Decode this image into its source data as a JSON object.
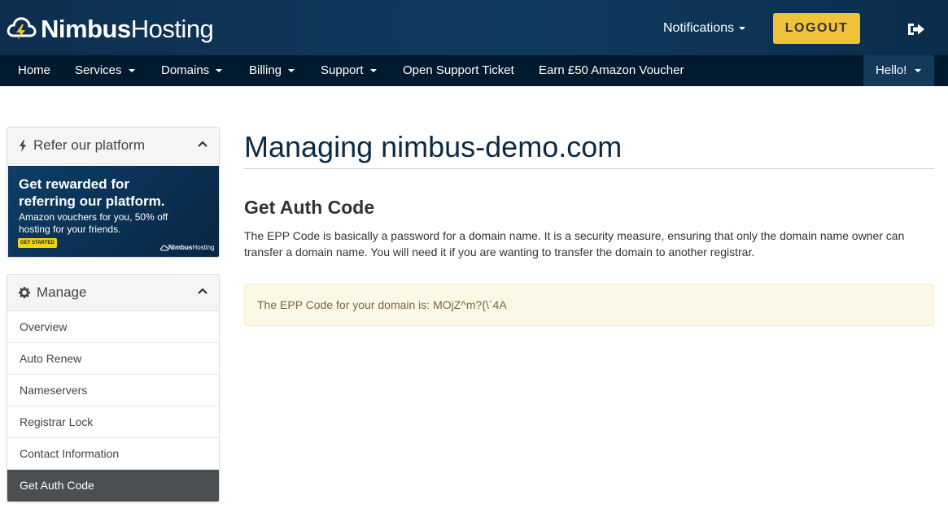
{
  "brand": {
    "bold": "Nimbus",
    "light": "Hosting"
  },
  "header": {
    "notifications_label": "Notifications",
    "logout_label": "LOGOUT"
  },
  "nav": {
    "items": [
      {
        "label": "Home"
      },
      {
        "label": "Services"
      },
      {
        "label": "Domains"
      },
      {
        "label": "Billing"
      },
      {
        "label": "Support"
      },
      {
        "label": "Open Support Ticket"
      },
      {
        "label": "Earn £50 Amazon Voucher"
      }
    ],
    "user_label": "Hello!"
  },
  "refer_panel": {
    "title": "Refer our platform",
    "promo_headline": "Get rewarded for referring our platform.",
    "promo_sub": "Amazon vouchers for you, 50% off hosting for your friends.",
    "promo_button": "GET STARTED",
    "promo_brand_bold": "Nimbus",
    "promo_brand_light": "Hosting"
  },
  "manage_panel": {
    "title": "Manage",
    "items": [
      {
        "label": "Overview"
      },
      {
        "label": "Auto Renew"
      },
      {
        "label": "Nameservers"
      },
      {
        "label": "Registrar Lock"
      },
      {
        "label": "Contact Information"
      },
      {
        "label": "Get Auth Code"
      }
    ],
    "active_item": "Get Auth Code"
  },
  "main": {
    "page_title": "Managing nimbus-demo.com",
    "section_title": "Get Auth Code",
    "description": "The EPP Code is basically a password for a domain name. It is a security measure, ensuring that only the domain name owner can transfer a domain name. You will need it if you are wanting to transfer the domain to another registrar.",
    "epp_message": "The EPP Code for your domain is: MOjZ^m?{\\`4A"
  },
  "colors": {
    "header_bg": "#0d2f4f",
    "nav_bg": "#021a2d",
    "logout_bg": "#f0c23b",
    "active_menu_bg": "#4b4f52",
    "alert_bg": "#fcf8e8"
  },
  "icons": {
    "logo": "cloud-lightning-icon",
    "signout": "sign-out-icon",
    "refer": "bolt-icon",
    "manage": "gear-icon",
    "collapse": "chevron-up-icon"
  }
}
